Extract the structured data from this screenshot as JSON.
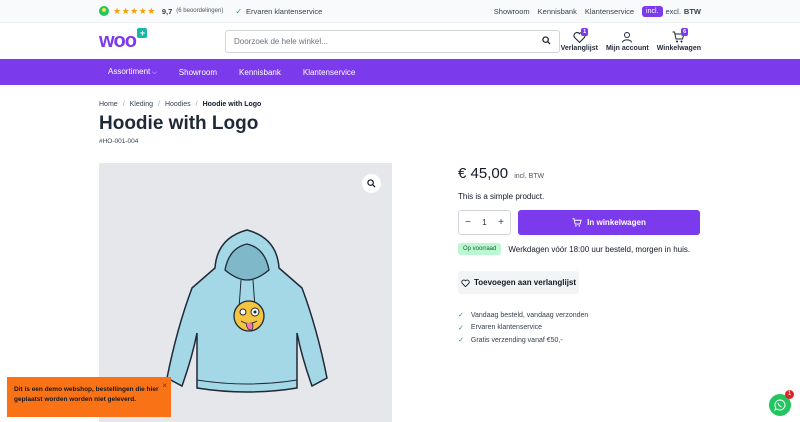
{
  "topbar": {
    "stars": "★★★★★",
    "rating": "9,7",
    "reviews": "(6 beoordelingen)",
    "service": "Ervaren klantenservice",
    "links": [
      "Showroom",
      "Kennisbank",
      "Klantenservice"
    ],
    "tax": {
      "incl": "incl.",
      "excl": "excl.",
      "label": "BTW"
    }
  },
  "header": {
    "logo": "woo",
    "logo_plus": "+",
    "search_placeholder": "Doorzoek de hele winkel...",
    "wishlist": {
      "label": "Verlanglijst",
      "count": "1"
    },
    "account": {
      "label": "Mijn account"
    },
    "cart": {
      "label": "Winkelwagen",
      "count": "6"
    }
  },
  "nav": {
    "items": [
      "Assortiment",
      "Showroom",
      "Kennisbank",
      "Klantenservice"
    ]
  },
  "breadcrumb": [
    "Home",
    "Kleding",
    "Hoodies",
    "Hoodie with Logo"
  ],
  "product": {
    "title": "Hoodie with Logo",
    "sku": "#HO-001-004",
    "price": "€ 45,00",
    "price_suffix": "incl. BTW",
    "short_description": "This is a simple product.",
    "quantity": "1",
    "add_to_cart": "In winkelwagen",
    "stock_badge": "Op voorraad",
    "delivery": "Werkdagen vóór 18:00 uur besteld, morgen in huis.",
    "wishlist": "Toevoegen aan verlanglijst",
    "usps": [
      "Vandaag besteld, vandaag verzonden",
      "Ervaren klantenservice",
      "Gratis verzending vanaf €50,-"
    ]
  },
  "notice": {
    "text": "Dit is een demo webshop, bestellingen die hier geplaatst worden worden niet geleverd.",
    "close": "×"
  },
  "whatsapp": {
    "badge": "1"
  },
  "colors": {
    "accent": "#7c3aed",
    "notice": "#f97316",
    "success": "#16a34a"
  }
}
